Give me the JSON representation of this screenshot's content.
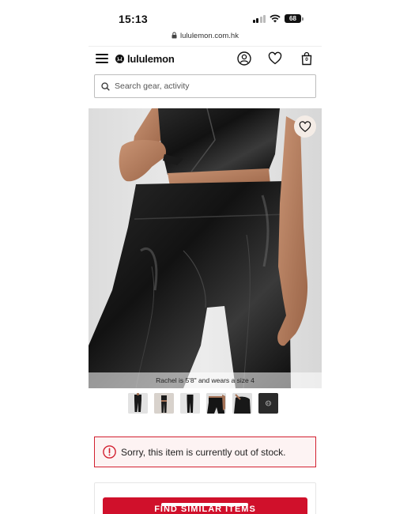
{
  "status_bar": {
    "time": "15:13",
    "battery": "68"
  },
  "browser": {
    "url": "lululemon.com.hk"
  },
  "header": {
    "brand": "lululemon",
    "icons": [
      "menu-icon",
      "account-icon",
      "heart-icon",
      "bag-icon"
    ],
    "bag_count": "0"
  },
  "search": {
    "placeholder": "Search gear, activity"
  },
  "product_image": {
    "caption": "Rachel is 5'8\" and wears a size 4",
    "favorite_icon": "heart-icon"
  },
  "thumbnails": [
    {
      "name": "thumbnail-1"
    },
    {
      "name": "thumbnail-2"
    },
    {
      "name": "thumbnail-3"
    },
    {
      "name": "thumbnail-4",
      "selected": true
    },
    {
      "name": "thumbnail-5"
    },
    {
      "name": "thumbnail-6"
    }
  ],
  "stock_alert": {
    "icon": "alert-circle-icon",
    "message": "Sorry, this item is currently out of stock."
  },
  "cta": {
    "label": "FIND SIMILAR ITEMS"
  },
  "colors": {
    "brand_red": "#d0102b",
    "alert_border": "#d22030"
  }
}
